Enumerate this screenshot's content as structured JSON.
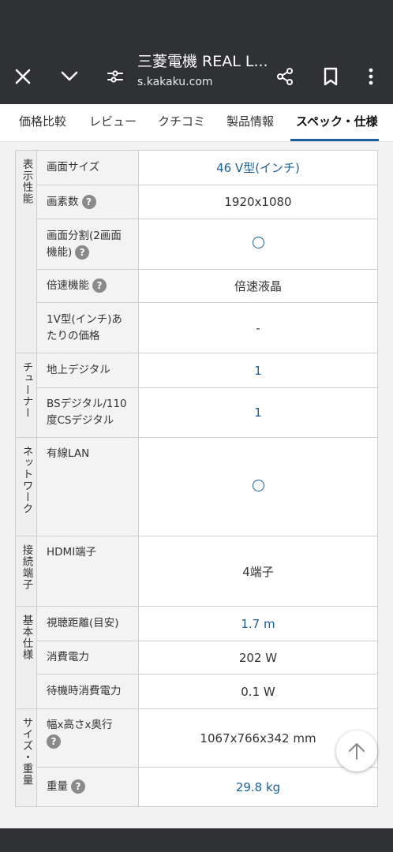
{
  "browser": {
    "title": "三菱電機 REAL L...",
    "url": "s.kakaku.com",
    "icons": [
      "close-icon",
      "chevron-down-icon",
      "page-info-icon",
      "share-icon",
      "bookmark-icon",
      "more-vert-icon"
    ]
  },
  "tabs": [
    {
      "label": "価格比較",
      "active": false
    },
    {
      "label": "レビュー",
      "active": false
    },
    {
      "label": "クチコミ",
      "active": false
    },
    {
      "label": "製品情報",
      "active": false
    },
    {
      "label": "スペック・仕様",
      "active": true
    }
  ],
  "spec": {
    "groups": [
      {
        "category": "表示性能",
        "rows": [
          {
            "label": "画面サイズ",
            "value": "46 V型(インチ)"
          },
          {
            "label": "画素数",
            "value": "1920x1080"
          },
          {
            "label": "画面分割(2画面機能)",
            "value": "○"
          },
          {
            "label": "倍速機能",
            "value": "倍速液晶"
          },
          {
            "label": "1V型(インチ)あたりの価格",
            "value": "-"
          }
        ]
      },
      {
        "category": "チューナー",
        "rows": [
          {
            "label": "地上デジタル",
            "value": "1"
          },
          {
            "label": "BSデジタル/110度CSデジタル",
            "value": "1"
          }
        ]
      },
      {
        "category": "ネットワーク",
        "rows": [
          {
            "label": "有線LAN",
            "value": "○"
          }
        ]
      },
      {
        "category": "接続端子",
        "rows": [
          {
            "label": "HDMI端子",
            "value": "4端子"
          }
        ]
      },
      {
        "category": "基本仕様",
        "rows": [
          {
            "label": "視聴距離(目安)",
            "value": "1.7 m"
          },
          {
            "label": "消費電力",
            "value": "202 W"
          },
          {
            "label": "待機時消費電力",
            "value": "0.1 W"
          }
        ]
      },
      {
        "category": "サイズ・重量",
        "rows": [
          {
            "label": "幅x高さx奥行",
            "value": "1067x766x342 mm"
          },
          {
            "label": "重量",
            "value": "29.8 kg"
          }
        ]
      }
    ],
    "help_mark": "?"
  },
  "colors": {
    "chrome": "#303134",
    "link": "#1a5fa0",
    "tab_underline": "#1a5fa0"
  }
}
